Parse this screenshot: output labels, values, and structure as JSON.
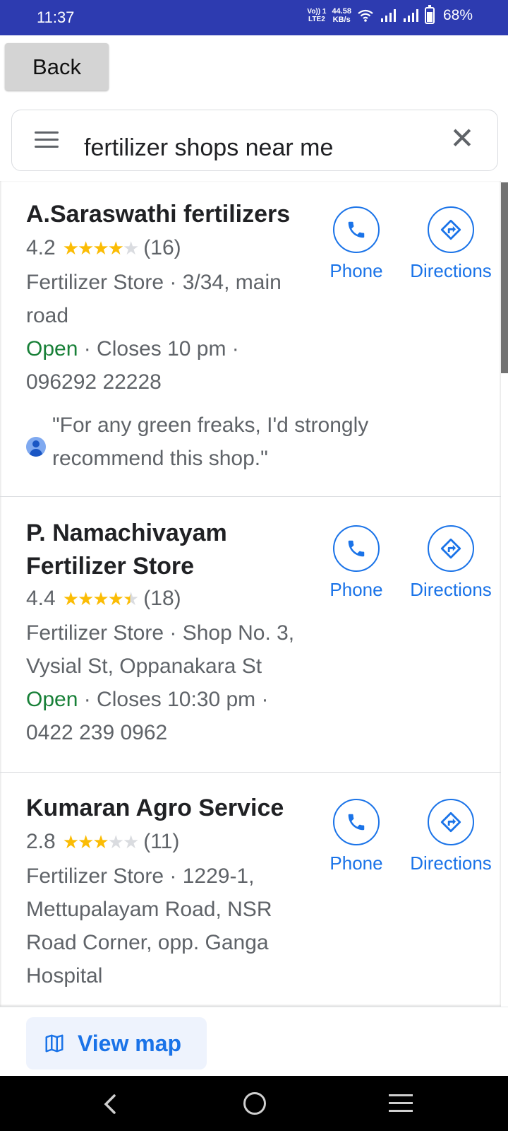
{
  "status_bar": {
    "time": "11:37",
    "volte_top": "Vo)) 1",
    "volte_bottom": "LTE2",
    "speed_top": "44.58",
    "speed_bottom": "KB/s",
    "battery": "68%",
    "battery_level": 0.68
  },
  "back_label": "Back",
  "search": {
    "query": "fertilizer shops near me",
    "clear_glyph": "✕"
  },
  "results": [
    {
      "name": "A.Saraswathi fertilizers",
      "rating": "4.2",
      "stars": "★★★★",
      "stars_off": "★",
      "count": "(16)",
      "info_line1": "Fertilizer Store · 3/34, main road",
      "open": "Open",
      "hours": " · Closes 10 pm · 096292 22228",
      "review": "\"For any green freaks, I'd strongly recommend this shop.\""
    },
    {
      "name": "P. Namachivayam Fertilizer Store",
      "rating": "4.4",
      "stars": "★★★★",
      "stars_off": "★",
      "count": "(18)",
      "info_line1": "Fertilizer Store · Shop No. 3, Vysial St, Oppanakara St",
      "open": "Open",
      "hours": " · Closes 10:30 pm · 0422 239 0962"
    },
    {
      "name": "Kumaran Agro Service",
      "rating": "2.8",
      "stars": "★★★",
      "stars_off": "★★",
      "count": "(11)",
      "info_line1": "Fertilizer Store · 1229-1, Mettupalayam Road, NSR Road Corner, opp. Ganga Hospital"
    }
  ],
  "actions": {
    "phone": "Phone",
    "directions": "Directions"
  },
  "view_map": "View map",
  "colors": {
    "accent": "#1a73e8",
    "open": "#188038",
    "star": "#fbbc04",
    "status_bar": "#2d3bb0"
  }
}
